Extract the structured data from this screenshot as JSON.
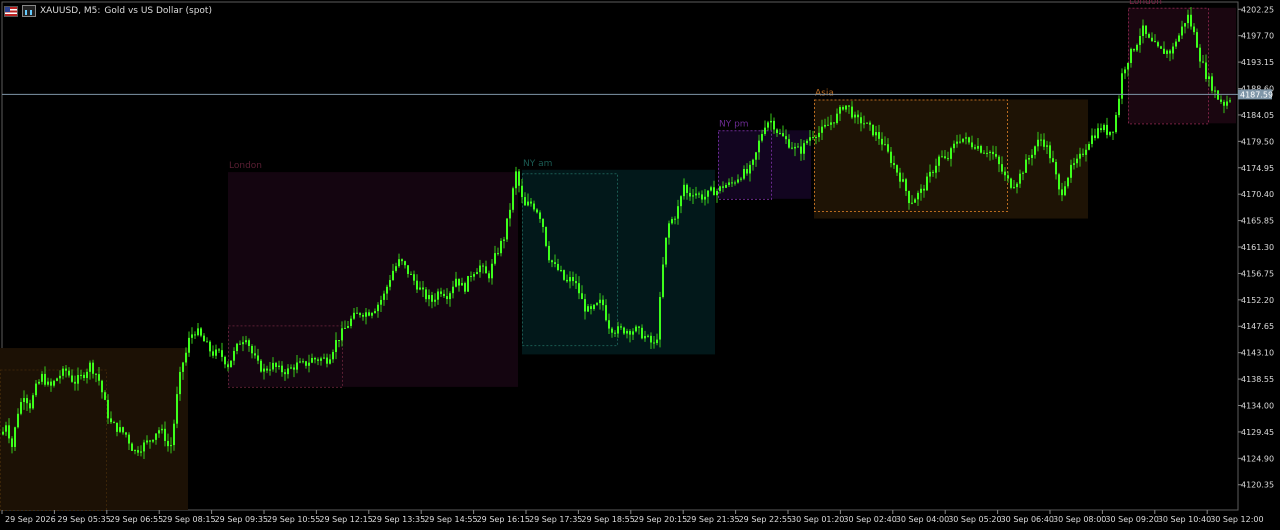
{
  "header": {
    "symbol": "XAUUSD, M5:",
    "description": "Gold vs US Dollar (spot)",
    "icons": [
      "flag-icon",
      "chart-icon"
    ]
  },
  "chart_data": {
    "type": "candlestick",
    "ylim": [
      4116.0,
      4203.5
    ],
    "price_ticks": [
      "4202.25",
      "4197.70",
      "4193.15",
      "4188.60",
      "4184.05",
      "4179.50",
      "4174.95",
      "4170.40",
      "4165.85",
      "4161.30",
      "4156.75",
      "4152.20",
      "4147.65",
      "4143.10",
      "4138.55",
      "4134.00",
      "4129.45",
      "4124.90",
      "4120.35"
    ],
    "time_ticks": [
      "29 Sep 2026",
      "29 Sep 05:35",
      "29 Sep 06:55",
      "29 Sep 08:15",
      "29 Sep 09:35",
      "29 Sep 10:55",
      "29 Sep 12:15",
      "29 Sep 13:35",
      "29 Sep 14:55",
      "29 Sep 16:15",
      "29 Sep 17:35",
      "29 Sep 18:55",
      "29 Sep 20:15",
      "29 Sep 21:35",
      "29 Sep 22:55",
      "30 Sep 01:20",
      "30 Sep 02:40",
      "30 Sep 04:00",
      "30 Sep 05:20",
      "30 Sep 06:40",
      "30 Sep 08:00",
      "30 Sep 09:20",
      "30 Sep 10:40",
      "30 Sep 12:00"
    ],
    "bid_line": 4187.59,
    "bid_label": "4187.59",
    "price_trace": [
      [
        0,
        4128
      ],
      [
        6,
        4131
      ],
      [
        12,
        4127
      ],
      [
        18,
        4133
      ],
      [
        24,
        4136
      ],
      [
        30,
        4134
      ],
      [
        36,
        4137
      ],
      [
        42,
        4139
      ],
      [
        50,
        4137
      ],
      [
        58,
        4139
      ],
      [
        66,
        4140
      ],
      [
        74,
        4138
      ],
      [
        82,
        4139
      ],
      [
        90,
        4141
      ],
      [
        98,
        4139
      ],
      [
        104,
        4135
      ],
      [
        110,
        4131
      ],
      [
        118,
        4130
      ],
      [
        126,
        4129
      ],
      [
        134,
        4126
      ],
      [
        142,
        4127
      ],
      [
        150,
        4128
      ],
      [
        158,
        4130
      ],
      [
        164,
        4129
      ],
      [
        170,
        4126
      ],
      [
        174,
        4131
      ],
      [
        178,
        4137
      ],
      [
        182,
        4141
      ],
      [
        186,
        4143
      ],
      [
        190,
        4146
      ],
      [
        196,
        4147
      ],
      [
        204,
        4145
      ],
      [
        212,
        4143
      ],
      [
        220,
        4143
      ],
      [
        228,
        4141
      ],
      [
        234,
        4143
      ],
      [
        240,
        4145
      ],
      [
        246,
        4146
      ],
      [
        252,
        4143
      ],
      [
        258,
        4141
      ],
      [
        264,
        4140
      ],
      [
        272,
        4141
      ],
      [
        280,
        4140
      ],
      [
        288,
        4140
      ],
      [
        296,
        4141
      ],
      [
        304,
        4141
      ],
      [
        312,
        4142
      ],
      [
        320,
        4142
      ],
      [
        328,
        4142
      ],
      [
        336,
        4145
      ],
      [
        344,
        4147
      ],
      [
        352,
        4149
      ],
      [
        360,
        4150
      ],
      [
        368,
        4150
      ],
      [
        376,
        4151
      ],
      [
        384,
        4153
      ],
      [
        392,
        4157
      ],
      [
        400,
        4159
      ],
      [
        408,
        4157
      ],
      [
        416,
        4155
      ],
      [
        424,
        4153
      ],
      [
        432,
        4152
      ],
      [
        440,
        4154
      ],
      [
        448,
        4153
      ],
      [
        456,
        4156
      ],
      [
        464,
        4154
      ],
      [
        472,
        4157
      ],
      [
        480,
        4158
      ],
      [
        488,
        4156
      ],
      [
        496,
        4160
      ],
      [
        504,
        4163
      ],
      [
        510,
        4168
      ],
      [
        516,
        4174
      ],
      [
        520,
        4171
      ],
      [
        524,
        4168
      ],
      [
        530,
        4169
      ],
      [
        536,
        4168
      ],
      [
        542,
        4166
      ],
      [
        548,
        4160
      ],
      [
        554,
        4158
      ],
      [
        560,
        4157
      ],
      [
        566,
        4155
      ],
      [
        572,
        4156
      ],
      [
        578,
        4154
      ],
      [
        584,
        4151
      ],
      [
        590,
        4150
      ],
      [
        596,
        4151
      ],
      [
        602,
        4152
      ],
      [
        608,
        4148
      ],
      [
        614,
        4147
      ],
      [
        620,
        4147
      ],
      [
        628,
        4147
      ],
      [
        636,
        4147
      ],
      [
        644,
        4146
      ],
      [
        650,
        4145
      ],
      [
        656,
        4144
      ],
      [
        660,
        4152
      ],
      [
        664,
        4160
      ],
      [
        668,
        4165
      ],
      [
        672,
        4166
      ],
      [
        676,
        4167
      ],
      [
        680,
        4169
      ],
      [
        684,
        4172
      ],
      [
        688,
        4170
      ],
      [
        694,
        4171
      ],
      [
        700,
        4170
      ],
      [
        706,
        4170
      ],
      [
        712,
        4171
      ],
      [
        718,
        4171
      ],
      [
        724,
        4172
      ],
      [
        730,
        4172
      ],
      [
        736,
        4173
      ],
      [
        742,
        4174
      ],
      [
        748,
        4174
      ],
      [
        754,
        4176
      ],
      [
        760,
        4180
      ],
      [
        766,
        4183
      ],
      [
        772,
        4183
      ],
      [
        778,
        4181
      ],
      [
        784,
        4180
      ],
      [
        790,
        4179
      ],
      [
        796,
        4178
      ],
      [
        802,
        4178
      ],
      [
        808,
        4180
      ],
      [
        814,
        4181
      ],
      [
        820,
        4181
      ],
      [
        826,
        4182
      ],
      [
        832,
        4183
      ],
      [
        838,
        4184
      ],
      [
        844,
        4186
      ],
      [
        850,
        4185
      ],
      [
        856,
        4183
      ],
      [
        862,
        4183
      ],
      [
        868,
        4182
      ],
      [
        874,
        4181
      ],
      [
        880,
        4180
      ],
      [
        886,
        4178
      ],
      [
        892,
        4176
      ],
      [
        898,
        4174
      ],
      [
        904,
        4172
      ],
      [
        910,
        4169
      ],
      [
        916,
        4170
      ],
      [
        922,
        4171
      ],
      [
        928,
        4173
      ],
      [
        934,
        4175
      ],
      [
        940,
        4177
      ],
      [
        946,
        4176
      ],
      [
        952,
        4178
      ],
      [
        958,
        4180
      ],
      [
        964,
        4180
      ],
      [
        970,
        4179
      ],
      [
        976,
        4179
      ],
      [
        982,
        4178
      ],
      [
        988,
        4178
      ],
      [
        994,
        4177
      ],
      [
        1000,
        4175
      ],
      [
        1006,
        4173
      ],
      [
        1012,
        4172
      ],
      [
        1018,
        4173
      ],
      [
        1024,
        4175
      ],
      [
        1030,
        4177
      ],
      [
        1036,
        4179
      ],
      [
        1042,
        4180
      ],
      [
        1048,
        4178
      ],
      [
        1054,
        4175
      ],
      [
        1060,
        4170
      ],
      [
        1066,
        4173
      ],
      [
        1072,
        4175
      ],
      [
        1078,
        4176
      ],
      [
        1084,
        4178
      ],
      [
        1090,
        4180
      ],
      [
        1096,
        4181
      ],
      [
        1102,
        4182
      ],
      [
        1108,
        4181
      ],
      [
        1114,
        4182
      ],
      [
        1118,
        4186
      ],
      [
        1122,
        4191
      ],
      [
        1126,
        4193
      ],
      [
        1132,
        4195
      ],
      [
        1138,
        4197
      ],
      [
        1142,
        4199
      ],
      [
        1148,
        4197
      ],
      [
        1154,
        4196
      ],
      [
        1160,
        4195
      ],
      [
        1166,
        4195
      ],
      [
        1172,
        4195
      ],
      [
        1176,
        4197
      ],
      [
        1180,
        4198
      ],
      [
        1184,
        4200
      ],
      [
        1188,
        4201
      ],
      [
        1192,
        4199
      ],
      [
        1196,
        4197
      ],
      [
        1200,
        4194
      ],
      [
        1206,
        4191
      ],
      [
        1212,
        4189
      ],
      [
        1218,
        4187
      ],
      [
        1224,
        4186
      ],
      [
        1230,
        4187
      ]
    ],
    "sessions": [
      {
        "label": "",
        "color": "#3a2408",
        "fill": "#1c1105",
        "x": [
          0,
          188
        ],
        "price": [
          4143.9,
          4116.0
        ],
        "inner_x": [
          0,
          106
        ],
        "inner_price": [
          4140.2,
          4116.0
        ]
      },
      {
        "label": "London",
        "color": "#5a1f33",
        "fill": "#140510",
        "x": [
          228,
          518
        ],
        "price": [
          4174.2,
          4137.2
        ],
        "inner_x": [
          228,
          342
        ],
        "inner_price": [
          4147.8,
          4137.2
        ]
      },
      {
        "label": "NY am",
        "color": "#1a5a52",
        "fill": "#02181a",
        "x": [
          522,
          715
        ],
        "price": [
          4174.6,
          4142.8
        ],
        "inner_x": [
          522,
          617
        ],
        "inner_price": [
          4174.0,
          4144.4
        ]
      },
      {
        "label": "NY pm",
        "color": "#6a2a90",
        "fill": "#120520",
        "x": [
          718,
          811
        ],
        "price": [
          4181.4,
          4169.6
        ],
        "inner_x": [
          718,
          771
        ],
        "inner_price": [
          4181.4,
          4169.6
        ]
      },
      {
        "label": "Asia",
        "color": "#b96b20",
        "fill": "#1e1305",
        "x": [
          814,
          1088
        ],
        "price": [
          4186.7,
          4166.2
        ],
        "inner_x": [
          814,
          1007
        ],
        "inner_price": [
          4186.7,
          4167.5
        ]
      },
      {
        "label": "London",
        "color": "#7a2244",
        "fill": "#1a0610",
        "x": [
          1128,
          1236
        ],
        "price": [
          4202.5,
          4182.6
        ],
        "inner_x": [
          1128,
          1208
        ],
        "inner_price": [
          4202.5,
          4182.6
        ]
      }
    ]
  }
}
